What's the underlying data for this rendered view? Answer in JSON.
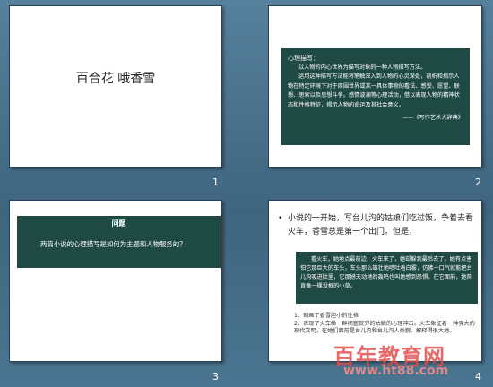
{
  "slides": [
    {
      "number": "1",
      "title": "百合花 哦香雪"
    },
    {
      "number": "2",
      "heading": "心理描写：",
      "body": [
        "以人物的内心世界为描写对象的一种人物描写方法。",
        "运用这种描写方法能将笔触深入到人物的心灵深处，剖析和揭示人物在特定环境下对于周围世界或某一具体事物的看法、感受、愿望、联想、思索以及思想斗争。感情波澜等心理活动，借以表现人物的精神状态和性格特征，揭示人物的命运及其社会意义。"
      ],
      "source": "——《写作艺术大辞典》"
    },
    {
      "number": "3",
      "panel_title": "问题",
      "question": "两篇小说的心理描写是如何为主题和人物服务的？"
    },
    {
      "number": "4",
      "bullet_symbol": "•",
      "bullet": "小说的一开始，写台儿沟的姑娘们吃过饭，争着去看火车，香雪总是第一个出门。但是，",
      "quote": "看火车，她地点最前边；火车来了，她却躲到最后去了。她有点害怕它那巨大的车头，车头那么雄壮地喷吐着白雾，仿佛一口气就能把台儿沟吸进肚里，它那撼天动地的轰鸣也叫她感到恐惧。在它面前，她简直像一棵没根的小草。",
      "list": [
        "1、刻画了香雪胆小的性格",
        "2、表现了火车给一群闭塞贫穷的姑娘的心理冲击。火车象征着一种强大的现代文明，在她们面前是台儿沟和台儿沟人类貌、解释得很大地。"
      ]
    }
  ],
  "watermark": {
    "text": "百年教育网",
    "url": "www.ht88.com"
  }
}
